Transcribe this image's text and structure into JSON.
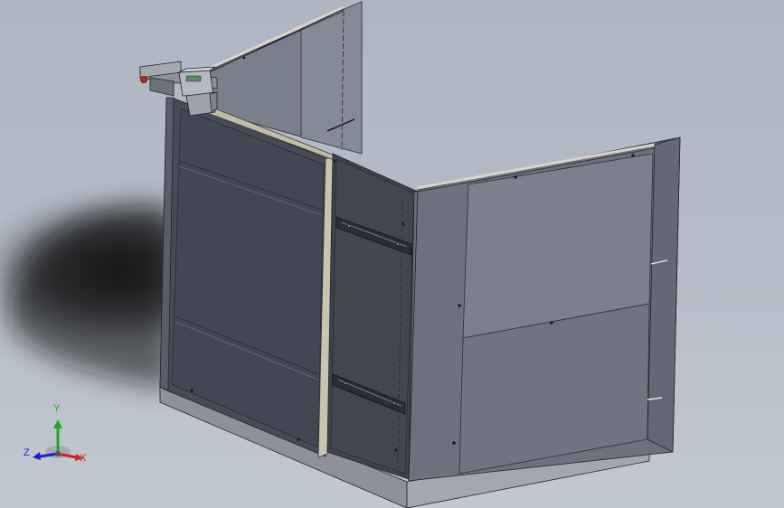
{
  "viewport": {
    "background_top": "#aeb6c3",
    "background_bottom": "#c2c8d1",
    "model_colors": {
      "panel_light": "#7b808d",
      "panel_mid": "#6b6f7d",
      "panel_dark": "#474a57",
      "panel_darker": "#3d404c",
      "edge": "#202229",
      "base": "#9a9da6",
      "rail": "#c9c4ad",
      "marker": "#c0281c"
    }
  },
  "triad": {
    "labels": {
      "x": "X",
      "y": "Y",
      "z": "Z"
    },
    "colors": {
      "x": "#d02020",
      "y": "#1fa81f",
      "z": "#2020c8"
    }
  }
}
